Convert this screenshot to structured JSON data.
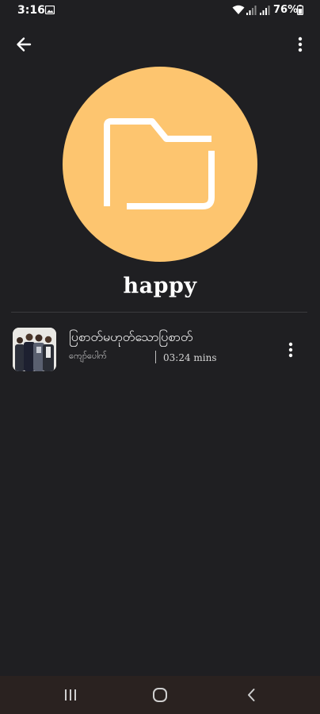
{
  "status_bar": {
    "time": "3:16",
    "battery_percent": "76%",
    "icons": [
      "gallery-icon",
      "wifi-icon",
      "signal-icon",
      "signal-icon",
      "battery-icon"
    ]
  },
  "app_bar": {
    "back_icon": "arrow-back-icon",
    "menu_icon": "more-vertical-icon"
  },
  "folder": {
    "name": "happy",
    "icon": "folder-icon",
    "circle_color": "#fdc56f"
  },
  "songs": [
    {
      "title": "ပြစာတ်မဟုတ်သောပြစာတ်",
      "artist": "ကျော်ပေါက်",
      "duration": "03:24 mins",
      "more_icon": "more-vertical-icon"
    }
  ],
  "nav_bar": {
    "icons": [
      "recents-icon",
      "home-icon",
      "back-icon"
    ]
  },
  "colors": {
    "background": "#1f1f22",
    "accent": "#fdc56f",
    "nav_background": "#2a2220"
  }
}
